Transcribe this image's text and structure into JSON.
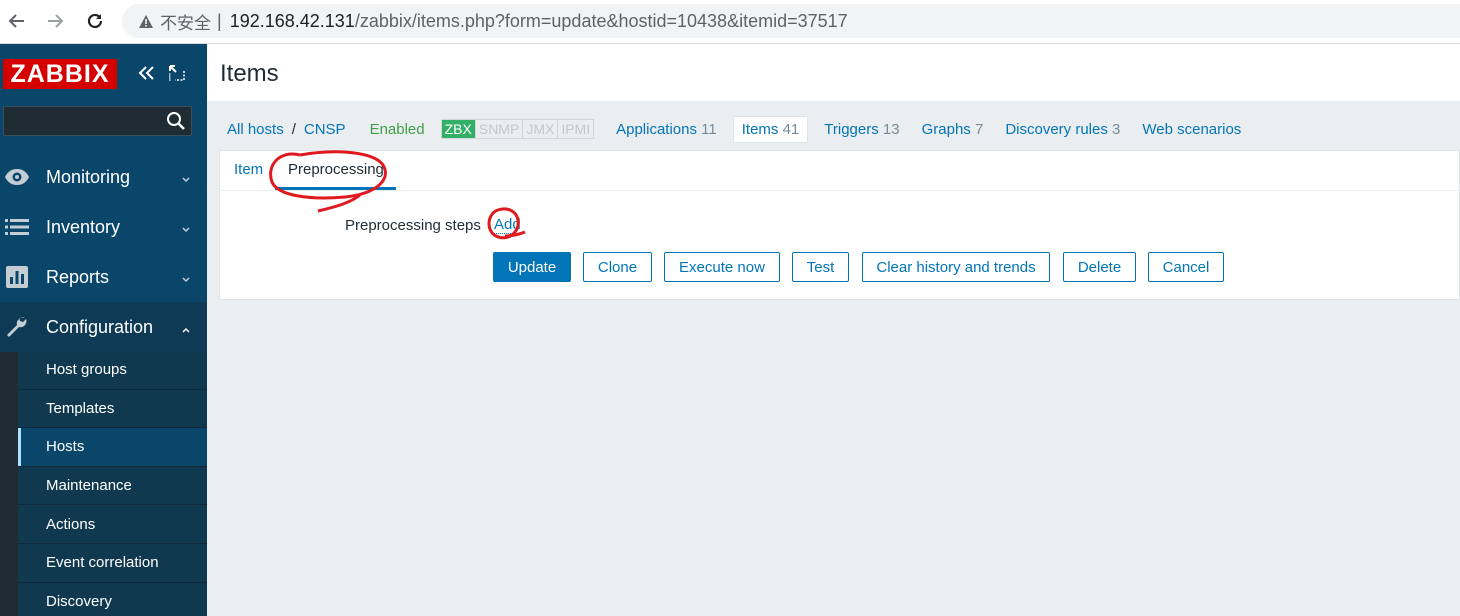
{
  "browser": {
    "security_warning": "不安全",
    "separator": "|",
    "url_host": "192.168.42.131",
    "url_path": "/zabbix/items.php?form=update&hostid=10438&itemid=37517"
  },
  "sidebar": {
    "logo": "ZABBIX",
    "menu": [
      {
        "label": "Monitoring",
        "icon": "eye-icon"
      },
      {
        "label": "Inventory",
        "icon": "list-icon"
      },
      {
        "label": "Reports",
        "icon": "bar-chart-icon"
      },
      {
        "label": "Configuration",
        "icon": "wrench-icon"
      }
    ],
    "submenu": [
      "Host groups",
      "Templates",
      "Hosts",
      "Maintenance",
      "Actions",
      "Event correlation",
      "Discovery"
    ],
    "active_submenu": "Hosts"
  },
  "page": {
    "title": "Items"
  },
  "host_nav": {
    "all_hosts": "All hosts",
    "crumb_sep": "/",
    "host": "CNSP",
    "status": "Enabled",
    "availability": [
      "ZBX",
      "SNMP",
      "JMX",
      "IPMI"
    ],
    "tabs": [
      {
        "label": "Applications",
        "count": "11"
      },
      {
        "label": "Items",
        "count": "41"
      },
      {
        "label": "Triggers",
        "count": "13"
      },
      {
        "label": "Graphs",
        "count": "7"
      },
      {
        "label": "Discovery rules",
        "count": "3"
      },
      {
        "label": "Web scenarios",
        "count": ""
      }
    ]
  },
  "form": {
    "tabs": [
      "Item",
      "Preprocessing"
    ],
    "active_tab": "Preprocessing",
    "preprocessing_label": "Preprocessing steps",
    "add_link": "Add",
    "buttons": [
      "Update",
      "Clone",
      "Execute now",
      "Test",
      "Clear history and trends",
      "Delete",
      "Cancel"
    ]
  },
  "colors": {
    "accent": "#0275b8",
    "sidebar_top": "#0a466a",
    "logo": "#d40000",
    "enabled": "#429e47",
    "zbx": "#34af67",
    "annotation": "#e0191e"
  }
}
